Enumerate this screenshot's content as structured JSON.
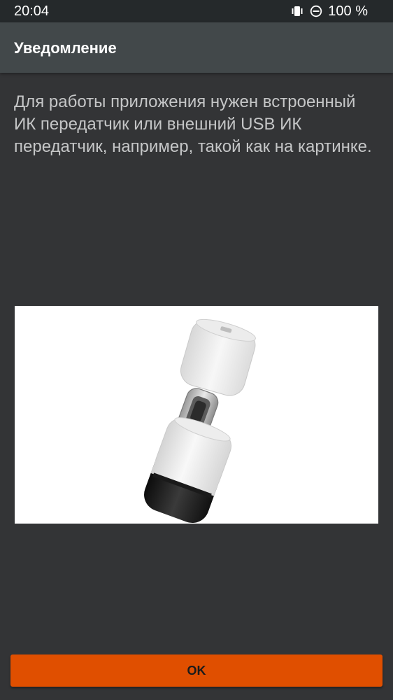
{
  "status_bar": {
    "time": "20:04",
    "battery": "100 %",
    "icons": [
      "vibrate-icon",
      "do-not-disturb-icon"
    ]
  },
  "app_bar": {
    "title": "Уведомление"
  },
  "message": {
    "text": "Для работы приложения нужен встроенный ИК передатчик или внешний USB ИК передатчик, например, такой как на картинке."
  },
  "illustration": {
    "subject": "usb-c-ir-transmitter-image"
  },
  "actions": {
    "ok_label": "OK"
  },
  "colors": {
    "background": "#333436",
    "status_bar": "#25292b",
    "app_bar": "#42484a",
    "accent": "#e04f00"
  }
}
